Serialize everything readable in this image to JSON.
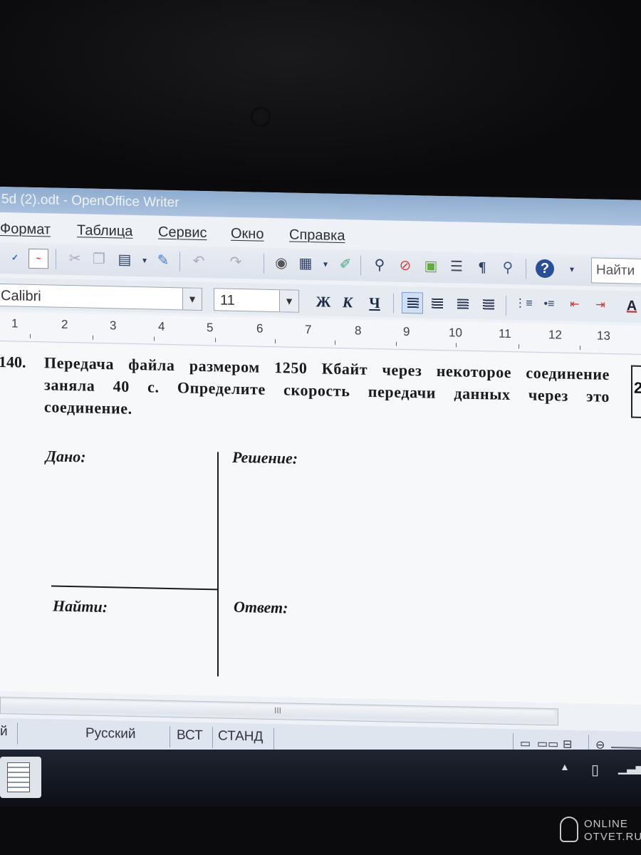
{
  "window": {
    "title": "5d (2).odt - OpenOffice Writer"
  },
  "menu": [
    "Формат",
    "Таблица",
    "Сервис",
    "Окно",
    "Справка"
  ],
  "toolbar": {
    "find_placeholder": "Найти"
  },
  "formatting": {
    "font_name": "Calibri",
    "font_size": "11",
    "bold_label": "Ж",
    "italic_label": "К",
    "underline_label": "Ч"
  },
  "ruler": [
    "1",
    "2",
    "3",
    "4",
    "5",
    "6",
    "7",
    "8",
    "9",
    "10",
    "11",
    "12",
    "13"
  ],
  "document": {
    "problem_number": "140.",
    "problem_text": "Передача файла размером 1250 Кбайт через некоторое соединение заняла 40 с. Определите скорость передачи данных через это соединение.",
    "right_box_number": "2",
    "given_label": "Дано:",
    "solution_label": "Решение:",
    "find_label": "Найти:",
    "answer_label": "Ответ:"
  },
  "scrollbar": {
    "thumb_label": "III"
  },
  "status": {
    "left_fragment": "й",
    "language": "Русский",
    "insert_mode": "ВСТ",
    "selection_mode": "СТАНД"
  },
  "watermark": {
    "line1": "ONLINE",
    "line2": "OTVET.RU"
  },
  "colors": {
    "accent": "#7d9cc6",
    "page": "#f7f8fa",
    "text": "#1a1a1c"
  }
}
